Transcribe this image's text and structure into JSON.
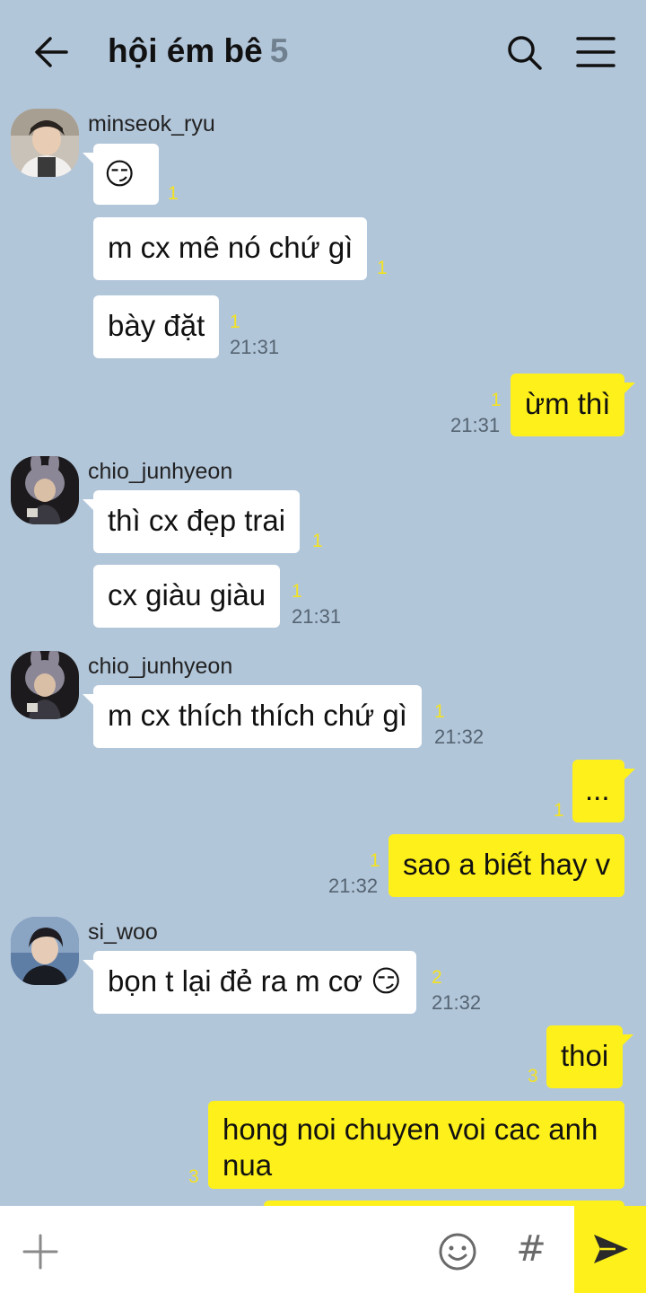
{
  "header": {
    "title": "hội ém bê",
    "member_count": "5",
    "back_icon": "arrow-left-icon",
    "search_icon": "search-icon",
    "menu_icon": "hamburger-menu-icon"
  },
  "messages": [
    {
      "sender": "minseok_ryu",
      "avatar": "avatar-minseok",
      "text": "😏",
      "unread": "1"
    },
    {
      "text": "m cx mê nó chứ gì",
      "unread": "1"
    },
    {
      "text": "bày đặt",
      "unread": "1",
      "time": "21:31"
    },
    {
      "mine": true,
      "text": "ừm thì",
      "unread": "1",
      "time": "21:31"
    },
    {
      "sender": "chio_junhyeon",
      "avatar": "avatar-chio",
      "text": "thì cx đẹp trai",
      "unread": "1"
    },
    {
      "text": "cx giàu giàu",
      "unread": "1",
      "time": "21:31"
    },
    {
      "sender": "chio_junhyeon",
      "avatar": "avatar-chio",
      "text": "m cx thích thích chứ gì",
      "unread": "1",
      "time": "21:32"
    },
    {
      "mine": true,
      "text": "...",
      "unread": "1"
    },
    {
      "mine": true,
      "text": "sao a biết hay v",
      "unread": "1",
      "time": "21:32"
    },
    {
      "sender": "si_woo",
      "avatar": "avatar-siwoo",
      "text": "bọn t lại đẻ ra m cơ 😏",
      "unread": "2",
      "time": "21:32"
    },
    {
      "mine": true,
      "text": "thoi",
      "unread": "3"
    },
    {
      "mine": true,
      "text": "hong noi chuyen voi cac anh nua",
      "unread": "3"
    }
  ],
  "input_bar": {
    "placeholder": "",
    "plus_icon": "plus-icon",
    "emoji_icon": "emoji-icon",
    "hash_label": "#",
    "send_icon": "send-icon"
  },
  "colors": {
    "background": "#b2c6da",
    "my_bubble": "#fef01b",
    "their_bubble": "#ffffff",
    "unread": "#f2e223"
  }
}
